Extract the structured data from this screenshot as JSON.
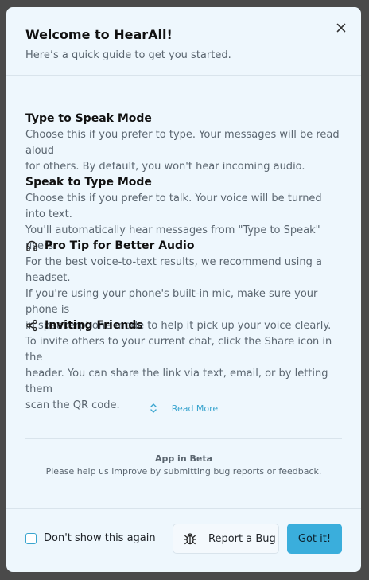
{
  "modal": {
    "title": "Welcome to HearAll!",
    "subtitle": "Here’s a quick guide to get you started."
  },
  "sections": [
    {
      "title": "Type to Speak Mode",
      "icon": "",
      "lines": [
        "Choose this if you prefer to type. Your messages will be read aloud",
        "for others. By default, you won't hear incoming audio."
      ]
    },
    {
      "title": "Speak to Type Mode",
      "icon": "",
      "lines": [
        "Choose this if you prefer to talk. Your voice will be turned into text.",
        "You'll automatically hear messages from \"Type to Speak\" users."
      ]
    },
    {
      "title": "Pro Tip for Better Audio",
      "icon": "headphones-icon",
      "lines": [
        "For the best voice-to-text results, we recommend using a headset.",
        "If you're using your phone's built-in mic, make sure your phone is",
        "in speakerphone mode to help it pick up your voice clearly."
      ]
    },
    {
      "title": "Inviting Friends",
      "icon": "share-icon",
      "lines": [
        "To invite others to your current chat, click the Share icon in the",
        "header. You can share the link via text, email, or by letting them",
        "scan the QR code."
      ]
    }
  ],
  "read_more": "Read More",
  "beta": {
    "title": "App in Beta",
    "body": "Please help us improve by submitting bug reports or feedback."
  },
  "footer": {
    "checkbox_label": "Don't show this again",
    "report_label": "Report a Bug",
    "got_it_label": "Got it!"
  },
  "colors": {
    "accent": "#3aaedc",
    "panel": "#eef7fd",
    "muted_text": "#5b6670"
  }
}
